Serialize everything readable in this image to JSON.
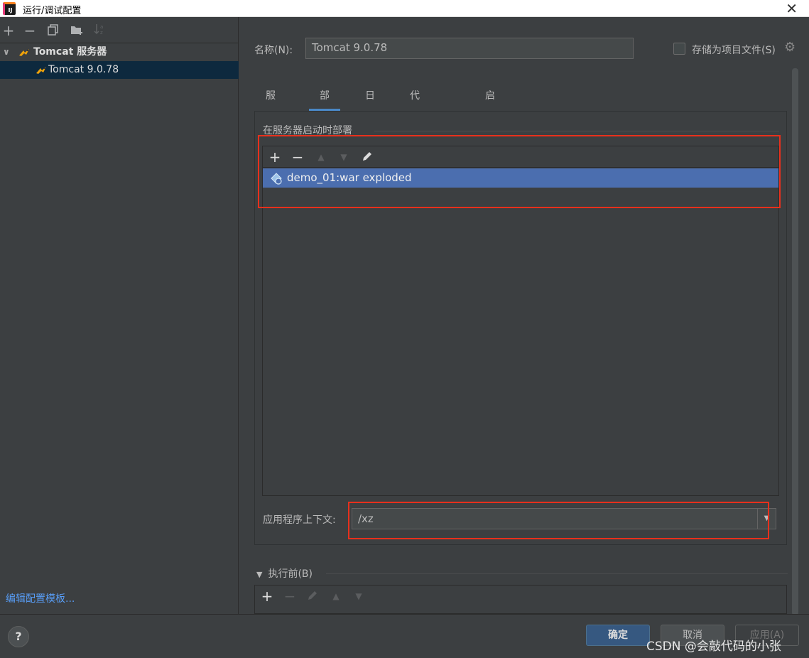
{
  "window": {
    "title": "运行/调试配置"
  },
  "sidebar": {
    "toolbar": {
      "add": "+",
      "remove": "−"
    },
    "tree": {
      "group_label": "Tomcat 服务器",
      "child_label": "Tomcat 9.0.78"
    },
    "edit_templates_link": "编辑配置模板..."
  },
  "form": {
    "name_label": "名称(N):",
    "name_value": "Tomcat 9.0.78",
    "store_as_project_file_label": "存储为项目文件(S)",
    "store_as_project_file_checked": false
  },
  "tabs": [
    {
      "label": "服务器",
      "active": false
    },
    {
      "label": "部署",
      "active": true
    },
    {
      "label": "日志",
      "active": false
    },
    {
      "label": "代码覆盖率",
      "active": false
    },
    {
      "label": "启动/连接",
      "active": false
    }
  ],
  "deploy": {
    "section_title": "在服务器启动时部署",
    "toolbar": {
      "add": "+",
      "remove": "−"
    },
    "items": [
      {
        "label": "demo_01:war exploded",
        "selected": true
      }
    ],
    "context_label": "应用程序上下文:",
    "context_value": "/xz"
  },
  "before_launch": {
    "label": "执行前(B)",
    "toolbar": {
      "add": "+",
      "remove": "−"
    }
  },
  "buttons": {
    "help": "?",
    "ok": "确定",
    "cancel": "取消",
    "apply": "应用(A)"
  },
  "watermark": "CSDN @会敲代码的小张",
  "colors": {
    "background": "#3c3f41",
    "selection": "#4b6eaf",
    "tree_selection": "#0d293e",
    "accent": "#4a88c7",
    "highlight_box": "#e8301c",
    "link": "#589df6"
  }
}
